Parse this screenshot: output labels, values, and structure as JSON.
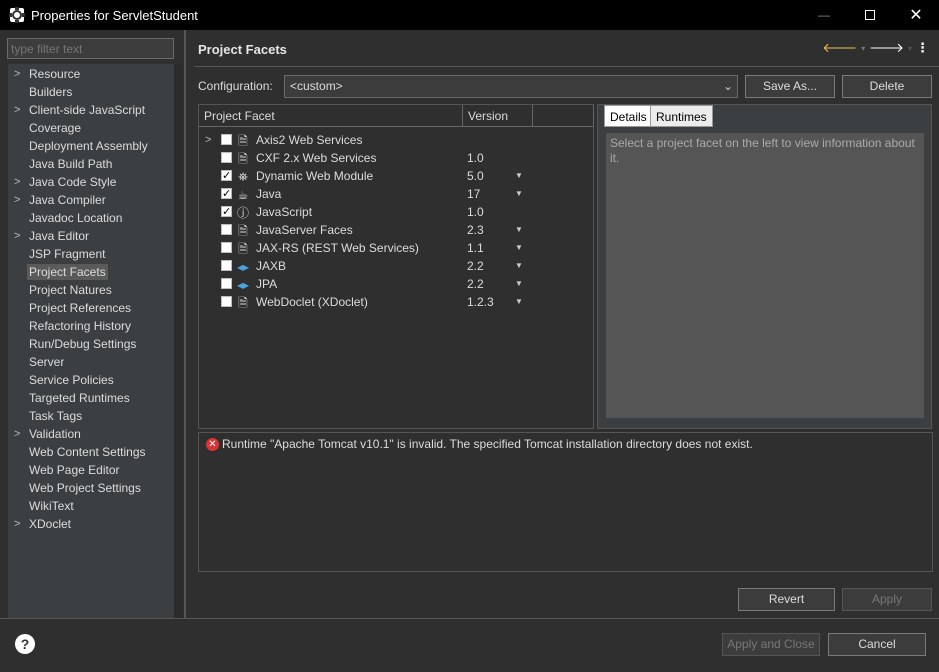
{
  "window": {
    "title": "Properties for ServletStudent"
  },
  "filter": {
    "placeholder": "type filter text"
  },
  "sidebar": {
    "items": [
      {
        "label": "Resource",
        "expandable": true
      },
      {
        "label": "Builders",
        "expandable": false
      },
      {
        "label": "Client-side JavaScript",
        "expandable": true
      },
      {
        "label": "Coverage",
        "expandable": false
      },
      {
        "label": "Deployment Assembly",
        "expandable": false
      },
      {
        "label": "Java Build Path",
        "expandable": false
      },
      {
        "label": "Java Code Style",
        "expandable": true
      },
      {
        "label": "Java Compiler",
        "expandable": true
      },
      {
        "label": "Javadoc Location",
        "expandable": false
      },
      {
        "label": "Java Editor",
        "expandable": true
      },
      {
        "label": "JSP Fragment",
        "expandable": false
      },
      {
        "label": "Project Facets",
        "expandable": false,
        "selected": true
      },
      {
        "label": "Project Natures",
        "expandable": false
      },
      {
        "label": "Project References",
        "expandable": false
      },
      {
        "label": "Refactoring History",
        "expandable": false
      },
      {
        "label": "Run/Debug Settings",
        "expandable": false
      },
      {
        "label": "Server",
        "expandable": false
      },
      {
        "label": "Service Policies",
        "expandable": false
      },
      {
        "label": "Targeted Runtimes",
        "expandable": false
      },
      {
        "label": "Task Tags",
        "expandable": false
      },
      {
        "label": "Validation",
        "expandable": true
      },
      {
        "label": "Web Content Settings",
        "expandable": false
      },
      {
        "label": "Web Page Editor",
        "expandable": false
      },
      {
        "label": "Web Project Settings",
        "expandable": false
      },
      {
        "label": "WikiText",
        "expandable": false
      },
      {
        "label": "XDoclet",
        "expandable": true
      }
    ]
  },
  "main": {
    "title": "Project Facets",
    "config_label": "Configuration:",
    "config_value": "<custom>",
    "save_as": "Save As...",
    "delete": "Delete",
    "table": {
      "col_facet": "Project Facet",
      "col_version": "Version",
      "rows": [
        {
          "name": "Axis2 Web Services",
          "version": "",
          "checked": false,
          "expandable": true,
          "icon": "page-icon",
          "dropdown": false
        },
        {
          "name": "CXF 2.x Web Services",
          "version": "1.0",
          "checked": false,
          "expandable": false,
          "icon": "page-icon",
          "dropdown": false
        },
        {
          "name": "Dynamic Web Module",
          "version": "5.0",
          "checked": true,
          "expandable": false,
          "icon": "web-module-icon",
          "dropdown": true
        },
        {
          "name": "Java",
          "version": "17",
          "checked": true,
          "expandable": false,
          "icon": "java-icon",
          "dropdown": true
        },
        {
          "name": "JavaScript",
          "version": "1.0",
          "checked": true,
          "expandable": false,
          "icon": "javascript-icon",
          "dropdown": false
        },
        {
          "name": "JavaServer Faces",
          "version": "2.3",
          "checked": false,
          "expandable": false,
          "icon": "page-icon",
          "dropdown": true
        },
        {
          "name": "JAX-RS (REST Web Services)",
          "version": "1.1",
          "checked": false,
          "expandable": false,
          "icon": "page-icon",
          "dropdown": true
        },
        {
          "name": "JAXB",
          "version": "2.2",
          "checked": false,
          "expandable": false,
          "icon": "jaxb-icon",
          "dropdown": true
        },
        {
          "name": "JPA",
          "version": "2.2",
          "checked": false,
          "expandable": false,
          "icon": "jpa-icon",
          "dropdown": true
        },
        {
          "name": "WebDoclet (XDoclet)",
          "version": "1.2.3",
          "checked": false,
          "expandable": false,
          "icon": "page-icon",
          "dropdown": true
        }
      ]
    },
    "tabs": {
      "details": "Details",
      "runtimes": "Runtimes"
    },
    "details_text": "Select a project facet on the left to view information about it.",
    "message": "Runtime \"Apache Tomcat v10.1\" is invalid. The specified Tomcat installation directory does not exist.",
    "revert": "Revert",
    "apply": "Apply"
  },
  "footer": {
    "apply_close": "Apply and Close",
    "cancel": "Cancel"
  }
}
